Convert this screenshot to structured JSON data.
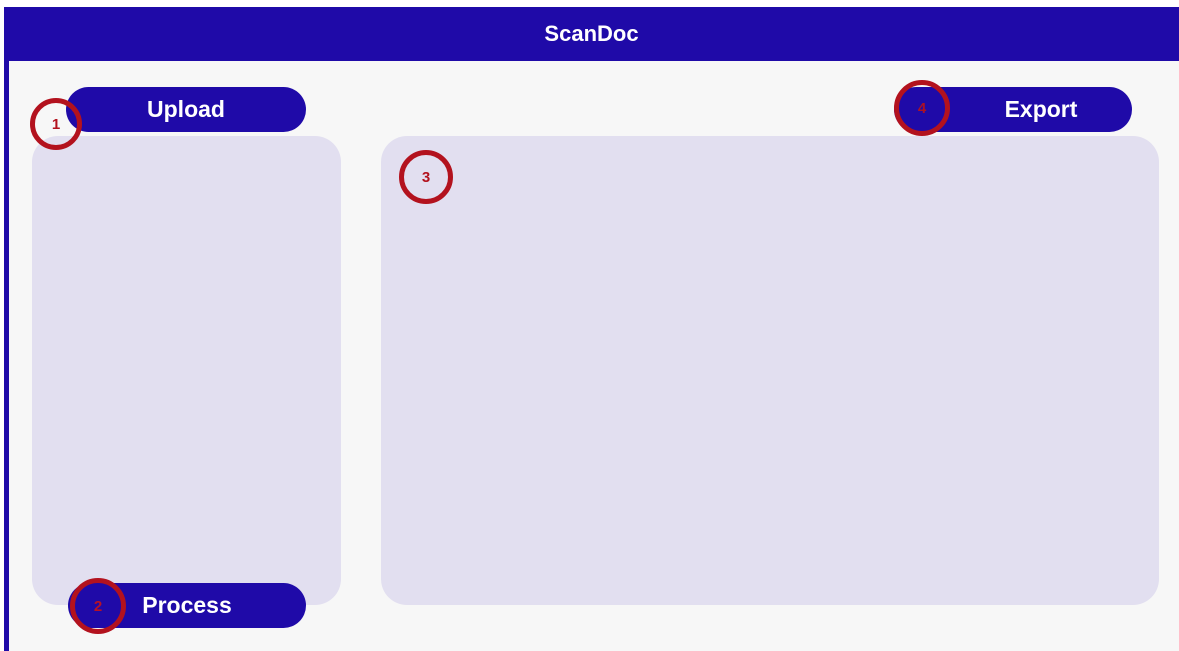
{
  "app": {
    "title": "ScanDoc"
  },
  "buttons": {
    "upload": "Upload",
    "process": "Process",
    "export": "Export"
  },
  "markers": [
    "1",
    "2",
    "3",
    "4"
  ],
  "colors": {
    "brand": "#1f0aa8",
    "panel": "#e2dff0",
    "background": "#f7f7f7",
    "marker": "#b3121e"
  }
}
